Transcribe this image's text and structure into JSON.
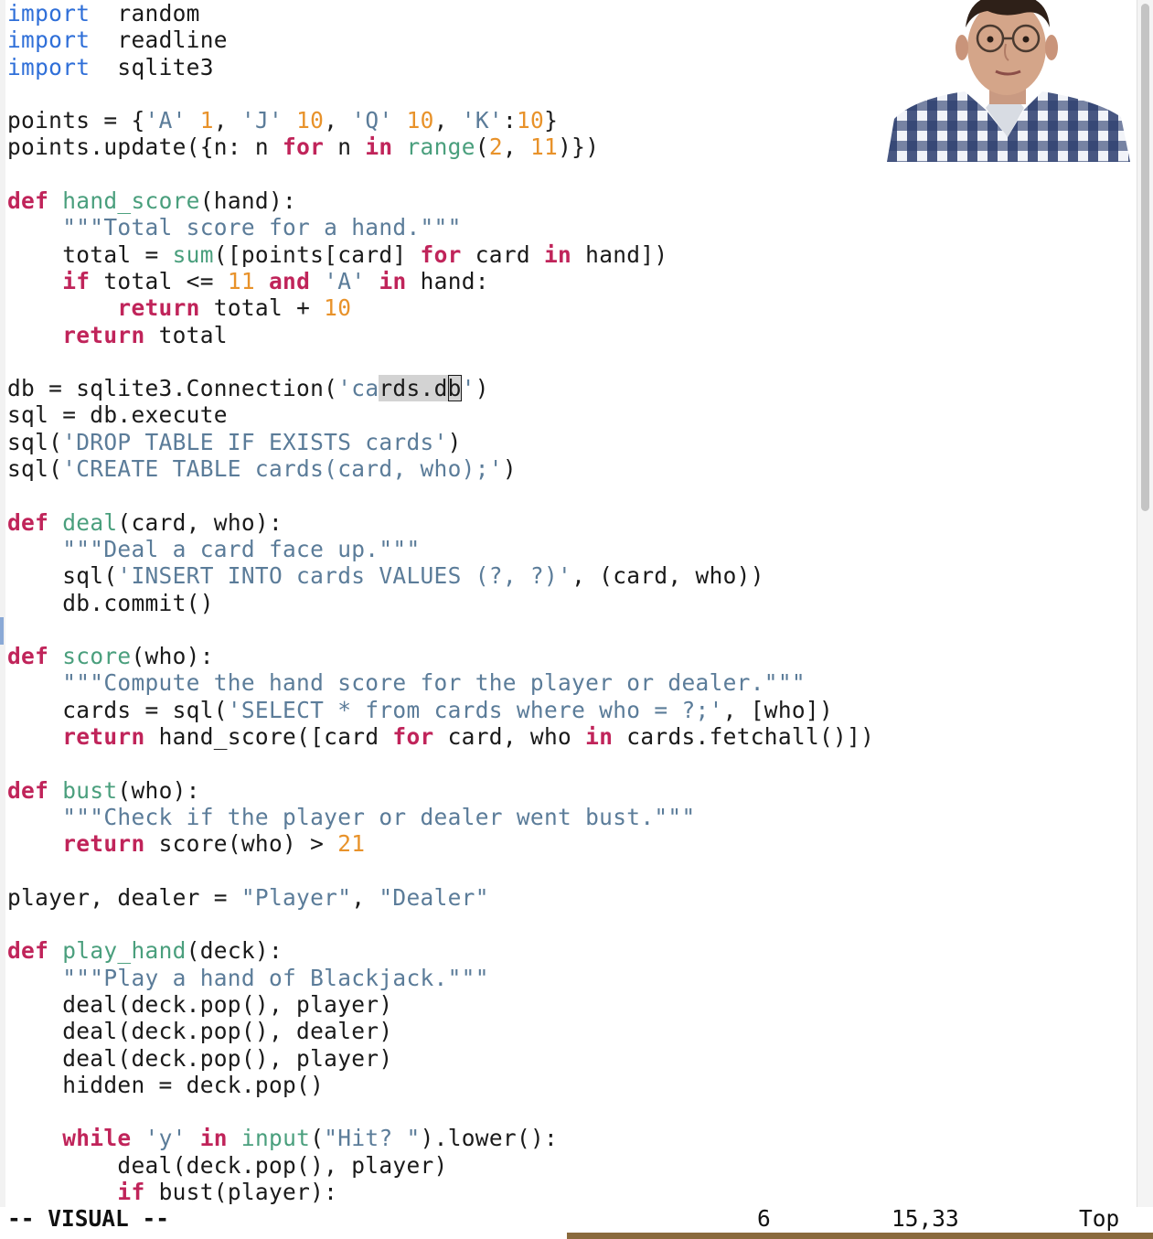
{
  "status": {
    "mode": "-- VISUAL --",
    "selection_count": "6",
    "cursor_position": "15,33",
    "scroll_position": "Top"
  },
  "colors": {
    "keyword": "#c0245a",
    "import": "#2f6fd8",
    "function_name": "#4a9f7d",
    "number": "#e8922a",
    "string": "#5b7c99",
    "selection": "#d3d3d3"
  },
  "code": [
    [
      [
        "imp",
        "import"
      ],
      [
        "",
        "  random"
      ]
    ],
    [
      [
        "imp",
        "import"
      ],
      [
        "",
        "  readline"
      ]
    ],
    [
      [
        "imp",
        "import"
      ],
      [
        "",
        "  sqlite3"
      ]
    ],
    [],
    [
      [
        "",
        "points = {"
      ],
      [
        "str",
        "'A'"
      ],
      [
        "",
        ": "
      ],
      [
        "num",
        "1"
      ],
      [
        "",
        ", "
      ],
      [
        "str",
        "'J'"
      ],
      [
        "",
        ": "
      ],
      [
        "num",
        "10"
      ],
      [
        "",
        ", "
      ],
      [
        "str",
        "'Q'"
      ],
      [
        "",
        ": "
      ],
      [
        "num",
        "10"
      ],
      [
        "",
        ", "
      ],
      [
        "str",
        "'K'"
      ],
      [
        "",
        ":"
      ],
      [
        "num",
        "10"
      ],
      [
        "",
        "}"
      ]
    ],
    [
      [
        "",
        "points.update({n: n "
      ],
      [
        "kw",
        "for"
      ],
      [
        "",
        ": n "
      ],
      [
        "kw",
        "in"
      ],
      [
        "",
        ": "
      ],
      [
        "bi",
        "range"
      ],
      [
        "",
        "("
      ],
      [
        "num",
        "2"
      ],
      [
        "",
        ", "
      ],
      [
        "num",
        "11"
      ],
      [
        "",
        ")})"
      ]
    ],
    [],
    [
      [
        "kw",
        "def"
      ],
      [
        "",
        ": "
      ],
      [
        "fn",
        "hand_score"
      ],
      [
        "",
        "(hand):"
      ]
    ],
    [
      [
        "",
        "    "
      ],
      [
        "doc",
        "\"\"\"Total score for a hand.\"\"\""
      ]
    ],
    [
      [
        "",
        "    total = "
      ],
      [
        "bi",
        "sum"
      ],
      [
        "",
        "([points[card] "
      ],
      [
        "kw",
        "for"
      ],
      [
        "",
        ": card "
      ],
      [
        "kw",
        "in"
      ],
      [
        "",
        ": hand])"
      ]
    ],
    [
      [
        "",
        "    "
      ],
      [
        "kw",
        "if"
      ],
      [
        "",
        ": total <= "
      ],
      [
        "num",
        "11"
      ],
      [
        "",
        ": "
      ],
      [
        "kw",
        "and"
      ],
      [
        "",
        ": "
      ],
      [
        "str",
        "'A'"
      ],
      [
        "",
        ": "
      ],
      [
        "kw",
        "in"
      ],
      [
        "",
        ": hand:"
      ]
    ],
    [
      [
        "",
        "        "
      ],
      [
        "kw",
        "return"
      ],
      [
        "",
        ": total + "
      ],
      [
        "num",
        "10"
      ]
    ],
    [
      [
        "",
        "    "
      ],
      [
        "kw",
        "return"
      ],
      [
        "",
        ": total"
      ]
    ],
    [],
    [
      [
        "",
        "db = sqlite3.Connection("
      ],
      [
        "str",
        "'ca"
      ],
      [
        "sel",
        "rds.d"
      ],
      [
        "cur",
        "b"
      ],
      [
        "str",
        "'"
      ],
      [
        "",
        ")"
      ]
    ],
    [
      [
        "",
        "sql = db.execute"
      ]
    ],
    [
      [
        "",
        "sql("
      ],
      [
        "str",
        "'DROP TABLE IF EXISTS cards'"
      ],
      [
        "",
        ")"
      ]
    ],
    [
      [
        "",
        "sql("
      ],
      [
        "str",
        "'CREATE TABLE cards(card, who);'"
      ],
      [
        "",
        ")"
      ]
    ],
    [],
    [
      [
        "kw",
        "def"
      ],
      [
        "",
        ": "
      ],
      [
        "fn",
        "deal"
      ],
      [
        "",
        "(card, who):"
      ]
    ],
    [
      [
        "",
        "    "
      ],
      [
        "doc",
        "\"\"\"Deal a card face up.\"\"\""
      ]
    ],
    [
      [
        "",
        "    sql("
      ],
      [
        "str",
        "'INSERT INTO cards VALUES (?, ?)'"
      ],
      [
        "",
        ", (card, who))"
      ]
    ],
    [
      [
        "",
        "    db.commit()"
      ]
    ],
    [],
    [
      [
        "kw",
        "def"
      ],
      [
        "",
        ": "
      ],
      [
        "fn",
        "score"
      ],
      [
        "",
        "(who):"
      ]
    ],
    [
      [
        "",
        "    "
      ],
      [
        "doc",
        "\"\"\"Compute the hand score for the player or dealer.\"\"\""
      ]
    ],
    [
      [
        "",
        "    cards = sql("
      ],
      [
        "str",
        "'SELECT * from cards where who = ?;'"
      ],
      [
        "",
        ", [who])"
      ]
    ],
    [
      [
        "",
        "    "
      ],
      [
        "kw",
        "return"
      ],
      [
        "",
        ": hand_score([card "
      ],
      [
        "kw",
        "for"
      ],
      [
        "",
        ": card, who "
      ],
      [
        "kw",
        "in"
      ],
      [
        "",
        ": cards.fetchall()])"
      ]
    ],
    [],
    [
      [
        "kw",
        "def"
      ],
      [
        "",
        ": "
      ],
      [
        "fn",
        "bust"
      ],
      [
        "",
        "(who):"
      ]
    ],
    [
      [
        "",
        "    "
      ],
      [
        "doc",
        "\"\"\"Check if the player or dealer went bust.\"\"\""
      ]
    ],
    [
      [
        "",
        "    "
      ],
      [
        "kw",
        "return"
      ],
      [
        "",
        ": score(who) > "
      ],
      [
        "num",
        "21"
      ]
    ],
    [],
    [
      [
        "",
        "player, dealer = "
      ],
      [
        "str",
        "\"Player\""
      ],
      [
        "",
        ", "
      ],
      [
        "str",
        "\"Dealer\""
      ]
    ],
    [],
    [
      [
        "kw",
        "def"
      ],
      [
        "",
        ": "
      ],
      [
        "fn",
        "play_hand"
      ],
      [
        "",
        "(deck):"
      ]
    ],
    [
      [
        "",
        "    "
      ],
      [
        "doc",
        "\"\"\"Play a hand of Blackjack.\"\"\""
      ]
    ],
    [
      [
        "",
        "    deal(deck.pop(), player)"
      ]
    ],
    [
      [
        "",
        "    deal(deck.pop(), dealer)"
      ]
    ],
    [
      [
        "",
        "    deal(deck.pop(), player)"
      ]
    ],
    [
      [
        "",
        "    hidden = deck.pop()"
      ]
    ],
    [],
    [
      [
        "",
        "    "
      ],
      [
        "kw",
        "while"
      ],
      [
        "",
        ": "
      ],
      [
        "str",
        "'y'"
      ],
      [
        "",
        ": "
      ],
      [
        "kw",
        "in"
      ],
      [
        "",
        ": "
      ],
      [
        "bi",
        "input"
      ],
      [
        "",
        "("
      ],
      [
        "str",
        "\"Hit? \""
      ],
      [
        "",
        ").lower():"
      ]
    ],
    [
      [
        "",
        "        deal(deck.pop(), player)"
      ]
    ],
    [
      [
        "",
        "        "
      ],
      [
        "kw",
        "if"
      ],
      [
        "",
        ": bust(player):"
      ]
    ]
  ]
}
